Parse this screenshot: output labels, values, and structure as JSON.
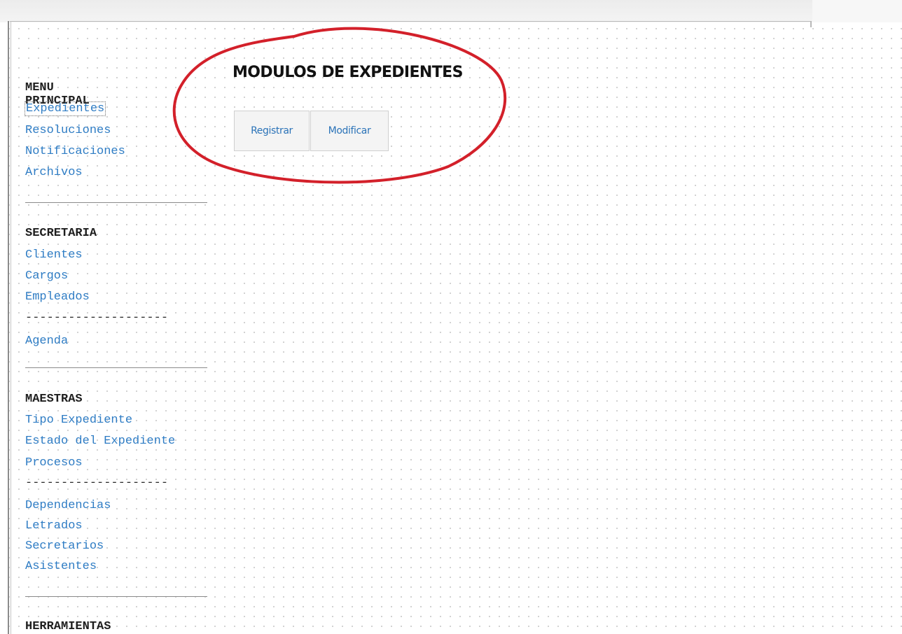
{
  "menu_principal": {
    "heading": "MENU PRINCIPAL",
    "items": [
      "Expedientes",
      "Resoluciones",
      "Notificaciones",
      "Archivos"
    ]
  },
  "secretaria": {
    "heading": "SECRETARIA",
    "items": [
      "Clientes",
      "Cargos",
      "Empleados"
    ],
    "separator": "--------------------",
    "extra": [
      "Agenda"
    ]
  },
  "maestras": {
    "heading": "MAESTRAS",
    "items": [
      "Tipo Expediente",
      "Estado del Expediente",
      "Procesos"
    ],
    "separator": "--------------------",
    "extra": [
      "Dependencias",
      "Letrados",
      "Secretarios",
      "Asistentes"
    ]
  },
  "herramientas": {
    "heading": "HERRAMIENTAS"
  },
  "main": {
    "title": "MODULOS DE EXPEDIENTES",
    "buttons": {
      "register_label": "Registrar",
      "modify_label": "Modificar"
    }
  },
  "colors": {
    "link": "#2e7cc4",
    "annotation_circle": "#d3202a"
  },
  "icons": []
}
